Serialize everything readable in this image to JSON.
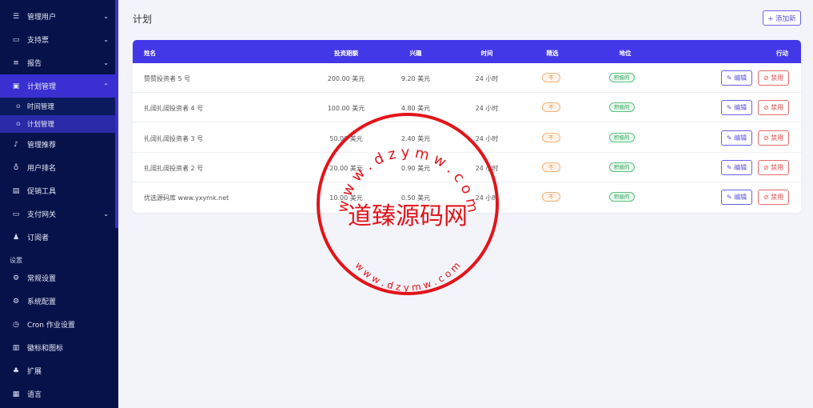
{
  "sidebar": {
    "items": [
      {
        "label": "管理用户",
        "icon": "users-icon",
        "glyph": "☰",
        "chevron": "⌄"
      },
      {
        "label": "支持票",
        "icon": "ticket-icon",
        "glyph": "▭",
        "chevron": "⌄"
      },
      {
        "label": "报告",
        "icon": "list-icon",
        "glyph": "≡",
        "chevron": "⌄"
      },
      {
        "label": "计划管理",
        "icon": "clipboard-icon",
        "glyph": "▣",
        "chevron": "⌃"
      }
    ],
    "sub_items": [
      {
        "label": "时间管理",
        "glyph": "⊙"
      },
      {
        "label": "计划管理",
        "glyph": "⊙"
      }
    ],
    "items2": [
      {
        "label": "管理推荐",
        "icon": "bell-icon",
        "glyph": "♪"
      },
      {
        "label": "用户排名",
        "icon": "medal-icon",
        "glyph": "♁"
      },
      {
        "label": "促销工具",
        "icon": "image-icon",
        "glyph": "▤"
      },
      {
        "label": "支付网关",
        "icon": "card-icon",
        "glyph": "▭",
        "chevron": "⌄"
      },
      {
        "label": "订阅者",
        "icon": "thumbs-up-icon",
        "glyph": "♟"
      }
    ],
    "section_label": "设置",
    "items3": [
      {
        "label": "常规设置",
        "icon": "settings-icon",
        "glyph": "⚙"
      },
      {
        "label": "系统配置",
        "icon": "gear-icon",
        "glyph": "⚙"
      },
      {
        "label": "Cron 作业设置",
        "icon": "clock-icon",
        "glyph": "◷"
      },
      {
        "label": "徽标和图标",
        "icon": "logo-icon",
        "glyph": "▥"
      },
      {
        "label": "扩展",
        "icon": "extension-icon",
        "glyph": "♣"
      },
      {
        "label": "语言",
        "icon": "language-icon",
        "glyph": "▦"
      }
    ]
  },
  "header": {
    "title": "计划",
    "add_label": "+ 添加新"
  },
  "table": {
    "columns": [
      "姓名",
      "投资期额",
      "兴趣",
      "时间",
      "精选",
      "地位",
      "行动"
    ],
    "rows": [
      {
        "name": "赞赞投资者 5 号",
        "amount": "200.00 美元",
        "interest": "9.20 美元",
        "time": "24 小时",
        "featured": "不",
        "status": "积极的"
      },
      {
        "name": "扎阔扎阔投资者 4 号",
        "amount": "100.00 美元",
        "interest": "4.80 美元",
        "time": "24 小时",
        "featured": "不",
        "status": "积极的"
      },
      {
        "name": "扎阔扎阔投资者 3 号",
        "amount": "50.00 美元",
        "interest": "2.40 美元",
        "time": "24 小时",
        "featured": "不",
        "status": "积极的"
      },
      {
        "name": "扎阔扎阔投资者 2 号",
        "amount": "20.00 美元",
        "interest": "0.90 美元",
        "time": "24 小时",
        "featured": "不",
        "status": "积极的"
      },
      {
        "name": "优选源码库 www.yxymk.net",
        "amount": "10.00 美元",
        "interest": "0.50 美元",
        "time": "24 小时",
        "featured": "不",
        "status": "积极的"
      }
    ],
    "edit_label": "✎ 编辑",
    "ban_label": "⊘ 禁用"
  },
  "watermark": {
    "main_text": "道臻源码网",
    "top_text": "w w w . d z y m w . c o m",
    "bottom_text": "w w w . d z y m w . c o m",
    "color": "#e3141b"
  }
}
